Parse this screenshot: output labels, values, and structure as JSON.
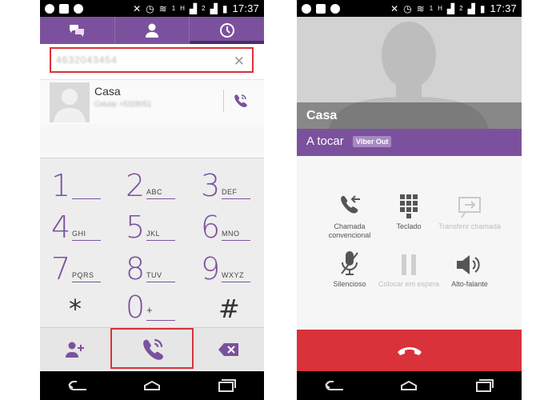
{
  "status_bar": {
    "left_icons": [
      "whatsapp-icon",
      "image-icon",
      "whatsapp-icon"
    ],
    "right_signal_1": "1",
    "right_signal_h": "H",
    "right_signal_2": "2",
    "time": "17:37"
  },
  "dialer": {
    "tabs": [
      "chat-icon",
      "contacts-icon",
      "recent-icon"
    ],
    "active_tab": "recent-icon",
    "number_value": "4632043454",
    "contact": {
      "name": "Casa",
      "subtitle": "Celular +5328051"
    },
    "keys": [
      {
        "digit": "1",
        "letters": ""
      },
      {
        "digit": "2",
        "letters": "ABC"
      },
      {
        "digit": "3",
        "letters": "DEF"
      },
      {
        "digit": "4",
        "letters": "GHI"
      },
      {
        "digit": "5",
        "letters": "JKL"
      },
      {
        "digit": "6",
        "letters": "MNO"
      },
      {
        "digit": "7",
        "letters": "PQRS"
      },
      {
        "digit": "8",
        "letters": "TUV"
      },
      {
        "digit": "9",
        "letters": "WXYZ"
      },
      {
        "digit": "*",
        "letters": ""
      },
      {
        "digit": "0",
        "letters": "+"
      },
      {
        "digit": "#",
        "letters": ""
      }
    ],
    "accent_color": "#7b519d"
  },
  "call_screen": {
    "contact_name": "Casa",
    "status": "A tocar",
    "badge": "Viber Out",
    "controls": [
      {
        "label": "Chamada convencional",
        "icon": "phone-arrow-icon",
        "enabled": true
      },
      {
        "label": "Teclado",
        "icon": "keypad-icon",
        "enabled": true
      },
      {
        "label": "Transferir chamada",
        "icon": "transfer-icon",
        "enabled": false
      },
      {
        "label": "Silencioso",
        "icon": "mic-muted-icon",
        "enabled": true
      },
      {
        "label": "Colocar em espera",
        "icon": "pause-icon",
        "enabled": false
      },
      {
        "label": "Alto-falante",
        "icon": "speaker-icon",
        "enabled": true
      }
    ],
    "end_color": "#d9323a"
  }
}
